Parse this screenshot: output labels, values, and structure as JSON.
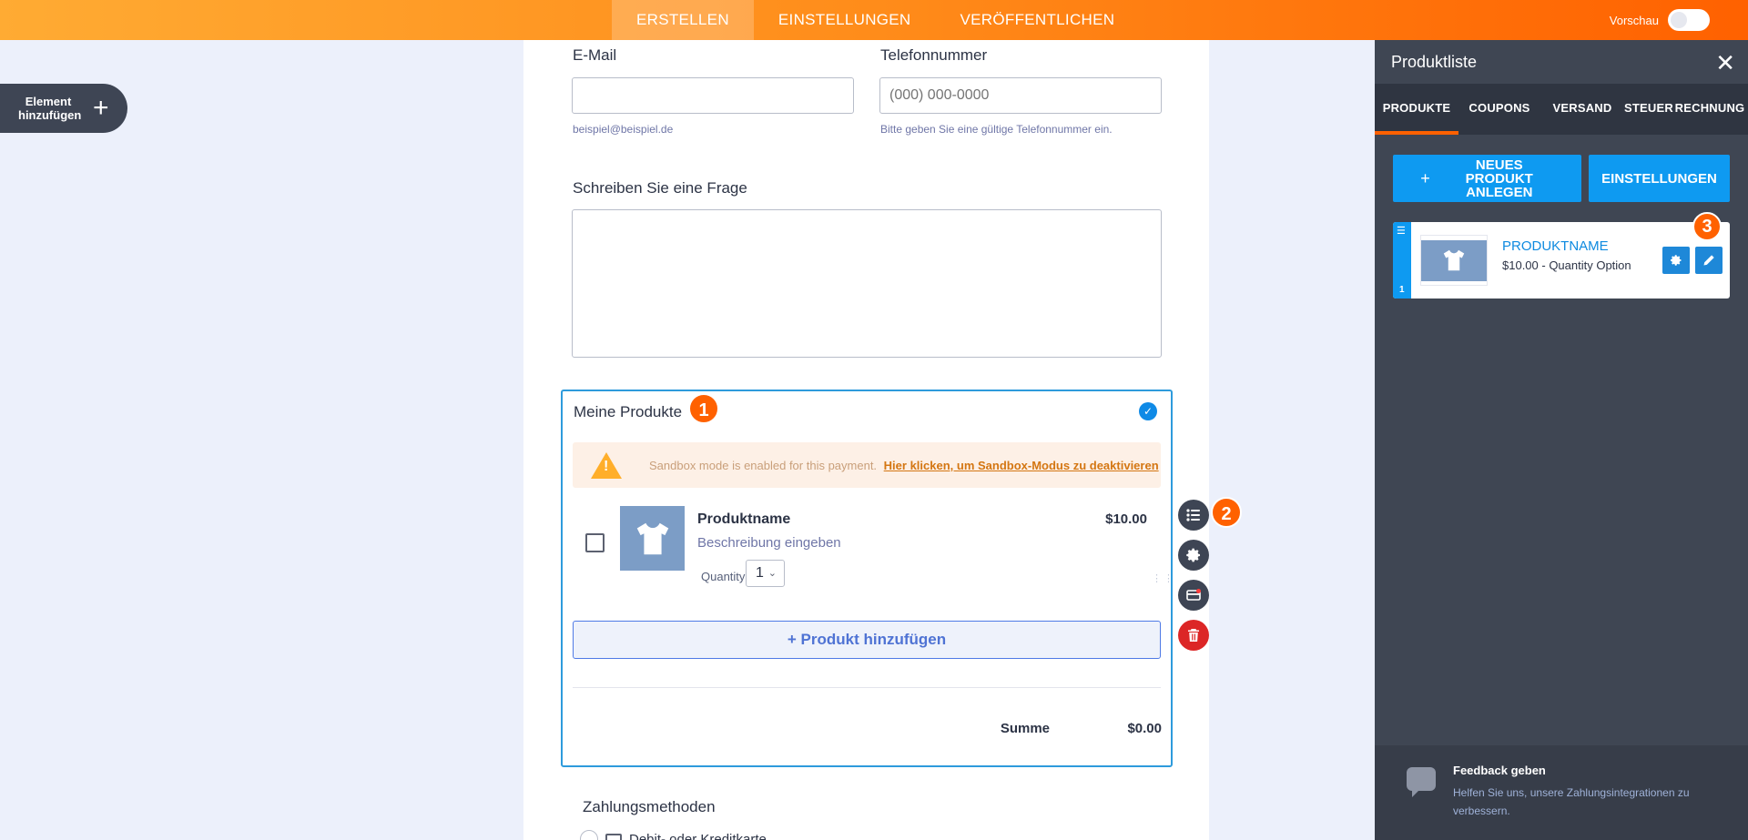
{
  "topbar": {
    "tabs": [
      "ERSTELLEN",
      "EINSTELLUNGEN",
      "VERÖFFENTLICHEN"
    ],
    "active_tab": 0,
    "preview_label": "Vorschau"
  },
  "add_element": {
    "label_line1": "Element",
    "label_line2": "hinzufügen",
    "icon": "plus-icon"
  },
  "form": {
    "email": {
      "label": "E-Mail",
      "value": "",
      "help": "beispiel@beispiel.de"
    },
    "phone": {
      "label": "Telefonnummer",
      "placeholder": "(000) 000-0000",
      "help": "Bitte geben Sie eine gültige Telefonnummer ein."
    },
    "question": {
      "label": "Schreiben Sie eine Frage"
    },
    "products": {
      "title": "Meine Produkte",
      "step_badge": "1",
      "sandbox_text": "Sandbox mode is enabled for this payment.",
      "sandbox_link": "Hier klicken, um Sandbox-Modus zu deaktivieren",
      "item": {
        "name": "Produktname",
        "description": "Beschreibung eingeben",
        "quantity_label": "Quantity",
        "quantity_value": "1",
        "price": "$10.00"
      },
      "add_product_label": "+ Produkt hinzufügen",
      "sum_label": "Summe",
      "sum_value": "$0.00"
    },
    "payment_methods": {
      "label": "Zahlungsmethoden",
      "option1": "Debit- oder Kreditkarte"
    }
  },
  "side_actions": {
    "step_badge": "2",
    "icons": [
      "list-icon",
      "gear-icon",
      "card-settings-icon",
      "trash-icon"
    ]
  },
  "panel": {
    "title": "Produktliste",
    "tabs": [
      "PRODUKTE",
      "COUPONS",
      "VERSAND",
      "STEUER",
      "RECHNUNG"
    ],
    "active_tab": 0,
    "new_product_button": "NEUES PRODUKT ANLEGEN",
    "settings_button": "EINSTELLUNGEN",
    "product_card": {
      "index": "1",
      "name": "PRODUKTNAME",
      "subtitle": "$10.00 - Quantity Option",
      "step_badge": "3"
    },
    "feedback": {
      "title": "Feedback geben",
      "text": "Helfen Sie uns, unsere Zahlungsintegrationen zu verbessern."
    }
  },
  "colors": {
    "accent_orange": "#ff6100",
    "accent_blue": "#0e9af1",
    "panel_bg": "#3f4653"
  }
}
